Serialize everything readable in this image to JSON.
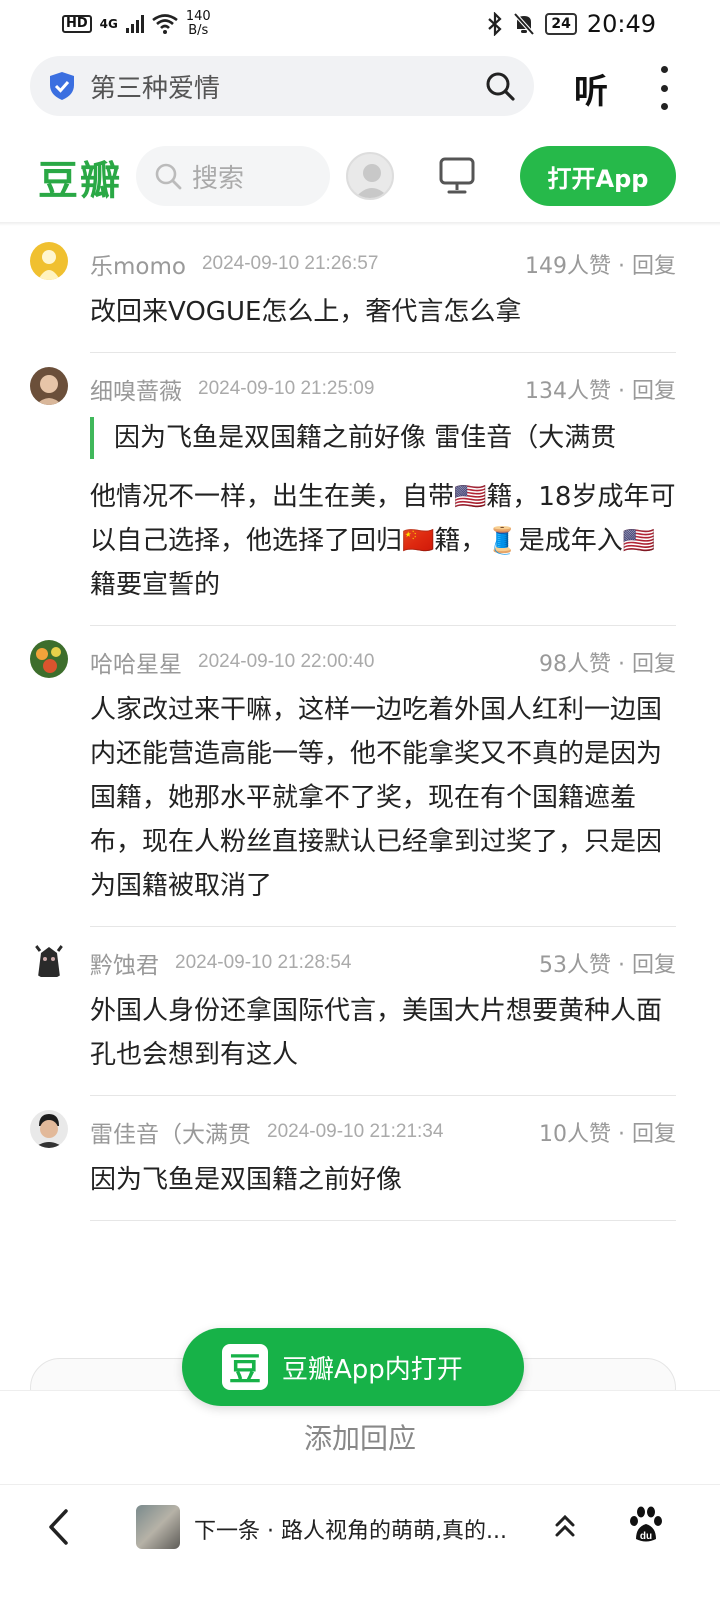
{
  "status_bar": {
    "hd": "HD",
    "network": "4G",
    "speed_value": "140",
    "speed_unit": "B/s",
    "battery": "24",
    "time": "20:49"
  },
  "browser": {
    "url_text": "第三种爱情",
    "listen_label": "听"
  },
  "douban_header": {
    "logo": "豆瓣",
    "search_placeholder": "搜索",
    "open_app_label": "打开App"
  },
  "comments": [
    {
      "author": "乐momo",
      "time": "2024-09-10 21:26:57",
      "likes": "149人赞 · 回复",
      "text": "改回来VOGUE怎么上，奢代言怎么拿"
    },
    {
      "author": "细嗅蔷薇",
      "time": "2024-09-10 21:25:09",
      "likes": "134人赞 · 回复",
      "quote": "因为飞鱼是双国籍之前好像 雷佳音（大满贯",
      "text": "他情况不一样，出生在美，自带🇺🇸籍，18岁成年可以自己选择，他选择了回归🇨🇳籍，🧵是成年入🇺🇸籍要宣誓的"
    },
    {
      "author": "哈哈星星",
      "time": "2024-09-10 22:00:40",
      "likes": "98人赞 · 回复",
      "text": "人家改过来干嘛，这样一边吃着外国人红利一边国内还能营造高能一等，他不能拿奖又不真的是因为国籍，她那水平就拿不了奖，现在有个国籍遮羞布，现在人粉丝直接默认已经拿到过奖了，只是因为国籍被取消了"
    },
    {
      "author": "黔蚀君",
      "time": "2024-09-10 21:28:54",
      "likes": "53人赞 · 回复",
      "text": "外国人身份还拿国际代言，美国大片想要黄种人面孔也会想到有这人"
    },
    {
      "author": "雷佳音（大满贯",
      "time": "2024-09-10 21:21:34",
      "likes": "10人赞 · 回复",
      "text": "因为飞鱼是双国籍之前好像"
    }
  ],
  "float_button": {
    "icon_text": "豆",
    "label": "豆瓣App内打开"
  },
  "add_reply": "添加回应",
  "bottom_nav": {
    "next_text": "下一条 · 路人视角的萌萌,真的..."
  },
  "colors": {
    "brand_green": "#26b94a",
    "quote_bar": "#40b85b"
  }
}
